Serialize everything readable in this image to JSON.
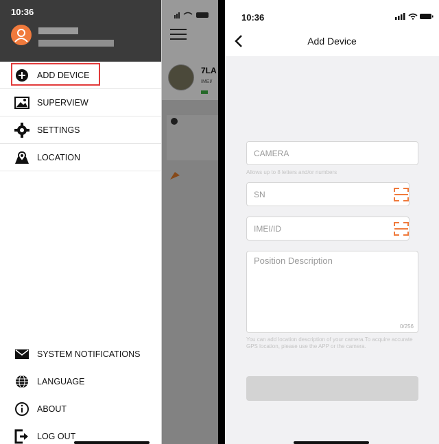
{
  "left_screen": {
    "status_time": "10:36",
    "background_device_name": "7LA",
    "background_device_sub": "IMEI/",
    "drawer_items": [
      {
        "label": "ADD DEVICE",
        "icon": "plus-circle-icon"
      },
      {
        "label": "SUPERVIEW",
        "icon": "image-icon"
      },
      {
        "label": "SETTINGS",
        "icon": "gear-icon"
      },
      {
        "label": "LOCATION",
        "icon": "map-pin-icon"
      }
    ],
    "drawer_bottom_items": [
      {
        "label": "SYSTEM NOTIFICATIONS",
        "icon": "envelope-icon"
      },
      {
        "label": "LANGUAGE",
        "icon": "globe-icon"
      },
      {
        "label": "ABOUT",
        "icon": "info-icon"
      },
      {
        "label": "LOG OUT",
        "icon": "logout-icon"
      }
    ]
  },
  "right_screen": {
    "status_time": "10:36",
    "title": "Add Device",
    "camera_placeholder": "CAMERA",
    "camera_hint": "Allows up to 8 letters and/or numbers",
    "sn_placeholder": "SN",
    "imei_placeholder": "IMEI/ID",
    "desc_placeholder": "Position Description",
    "desc_count": "0/256",
    "desc_hint": "You can add location description of your camera.To acquire accurate GPS location, please use the APP or the camera."
  },
  "colors": {
    "accent": "#f07a3c",
    "highlight": "#e23b3b"
  }
}
